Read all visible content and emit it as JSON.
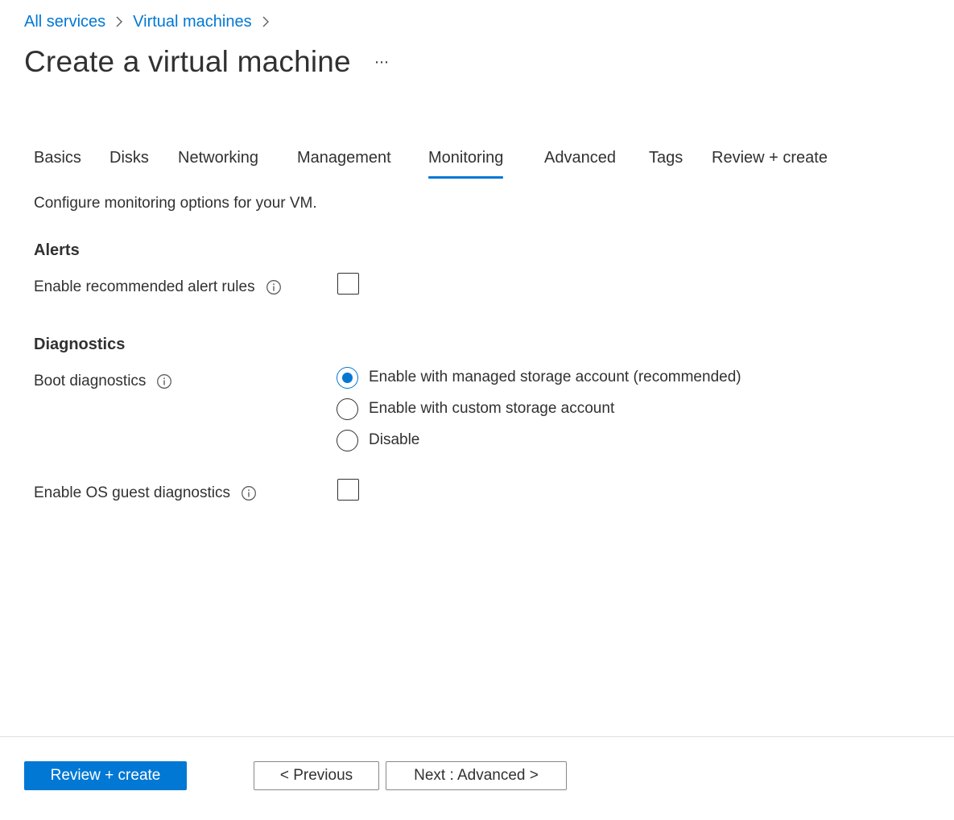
{
  "breadcrumb": {
    "items": [
      "All services",
      "Virtual machines"
    ]
  },
  "page": {
    "title": "Create a virtual machine",
    "more_label": "⋯"
  },
  "tabs": [
    {
      "label": "Basics",
      "active": false
    },
    {
      "label": "Disks",
      "active": false
    },
    {
      "label": "Networking",
      "active": false
    },
    {
      "label": "Management",
      "active": false
    },
    {
      "label": "Monitoring",
      "active": true
    },
    {
      "label": "Advanced",
      "active": false
    },
    {
      "label": "Tags",
      "active": false
    },
    {
      "label": "Review + create",
      "active": false
    }
  ],
  "intro": "Configure monitoring options for your VM.",
  "alerts": {
    "heading": "Alerts",
    "recommended_rules": {
      "label": "Enable recommended alert rules",
      "checked": false
    }
  },
  "diagnostics": {
    "heading": "Diagnostics",
    "boot": {
      "label": "Boot diagnostics",
      "options": [
        {
          "label": "Enable with managed storage account (recommended)",
          "selected": true
        },
        {
          "label": "Enable with custom storage account",
          "selected": false
        },
        {
          "label": "Disable",
          "selected": false
        }
      ]
    },
    "os_guest": {
      "label": "Enable OS guest diagnostics",
      "checked": false
    }
  },
  "footer": {
    "review_create": "Review + create",
    "previous": "< Previous",
    "next": "Next : Advanced >"
  },
  "colors": {
    "accent": "#0078d4",
    "text": "#323130",
    "border": "#8a8886"
  },
  "icons": {
    "breadcrumb_separator": "chevron-right-icon",
    "field_info": "info-icon",
    "more": "more-icon"
  }
}
